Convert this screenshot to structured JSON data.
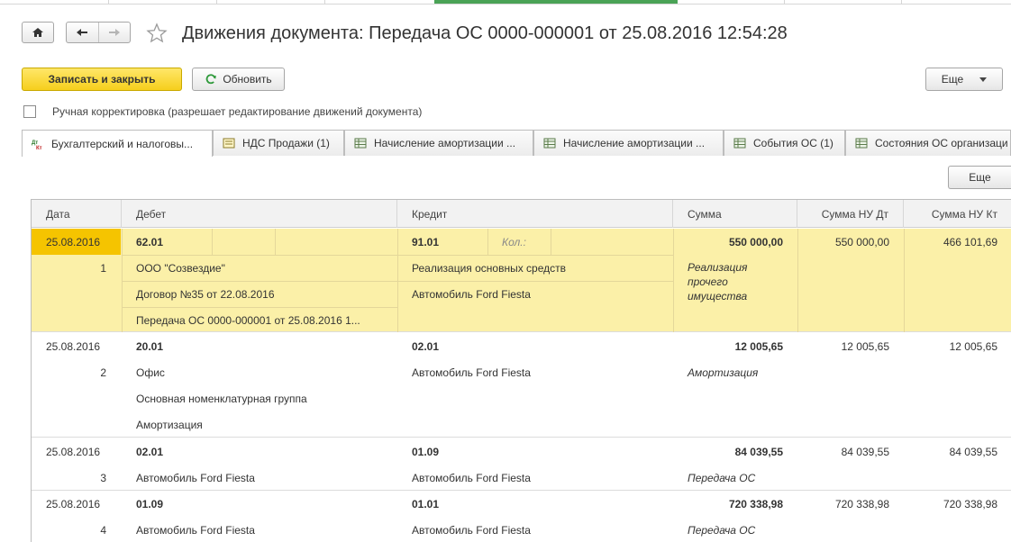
{
  "window": {
    "title": "Движения документа: Передача ОС 0000-000001 от 25.08.2016 12:54:28"
  },
  "toolbar": {
    "save_close": "Записать и закрыть",
    "refresh": "Обновить",
    "more": "Еще"
  },
  "manual_edit": {
    "label": "Ручная корректировка (разрешает редактирование движений документа)",
    "checked": false
  },
  "tabs": [
    {
      "label": "Бухгалтерский и налоговы...",
      "icon": "dt-kt-icon",
      "active": true
    },
    {
      "label": "НДС Продажи (1)",
      "icon": "register-icon",
      "active": false
    },
    {
      "label": "Начисление амортизации ...",
      "icon": "table-icon",
      "active": false
    },
    {
      "label": "Начисление амортизации ...",
      "icon": "table-icon",
      "active": false
    },
    {
      "label": "События ОС (1)",
      "icon": "table-icon",
      "active": false
    },
    {
      "label": "Состояния ОС организаци",
      "icon": "table-icon",
      "active": false
    }
  ],
  "table_more": "Еще",
  "columns": {
    "date": "Дата",
    "debit": "Дебет",
    "credit": "Кредит",
    "sum": "Сумма",
    "sum_nu_dt": "Сумма НУ Дт",
    "sum_nu_kt": "Сумма НУ Кт"
  },
  "records": [
    {
      "date": "25.08.2016",
      "num": "1",
      "debit_account": "62.01",
      "debit_sub": [
        "ООО \"Созвездие\"",
        "Договор №35 от 22.08.2016",
        "Передача ОС 0000-000001 от 25.08.2016 1..."
      ],
      "credit_account": "91.01",
      "credit_qty_label": "Кол.:",
      "credit_sub": [
        "Реализация основных средств",
        "Автомобиль Ford Fiesta"
      ],
      "sum": "550 000,00",
      "content": "Реализация прочего имущества",
      "sum_nu_dt": "550 000,00",
      "sum_nu_kt": "466 101,69"
    },
    {
      "date": "25.08.2016",
      "num": "2",
      "debit_account": "20.01",
      "debit_sub": [
        "Офис",
        "Основная номенклатурная группа",
        "Амортизация"
      ],
      "credit_account": "02.01",
      "credit_sub": [
        "Автомобиль Ford Fiesta"
      ],
      "sum": "12 005,65",
      "content": "Амортизация",
      "sum_nu_dt": "12 005,65",
      "sum_nu_kt": "12 005,65"
    },
    {
      "date": "25.08.2016",
      "num": "3",
      "debit_account": "02.01",
      "debit_sub": [
        "Автомобиль Ford Fiesta"
      ],
      "credit_account": "01.09",
      "credit_sub": [
        "Автомобиль Ford Fiesta"
      ],
      "sum": "84 039,55",
      "content": "Передача ОС",
      "sum_nu_dt": "84 039,55",
      "sum_nu_kt": "84 039,55"
    },
    {
      "date": "25.08.2016",
      "num": "4",
      "debit_account": "01.09",
      "debit_sub": [
        "Автомобиль Ford Fiesta"
      ],
      "credit_account": "01.01",
      "credit_sub": [
        "Автомобиль Ford Fiesta"
      ],
      "sum": "720 338,98",
      "content": "Передача ОС",
      "sum_nu_dt": "720 338,98",
      "sum_nu_kt": "720 338,98"
    }
  ],
  "colors": {
    "accent_yellow": "#f6cf1c",
    "selected_row": "#fbf0a8",
    "selected_date": "#f5c400",
    "active_green": "#4aa356"
  }
}
